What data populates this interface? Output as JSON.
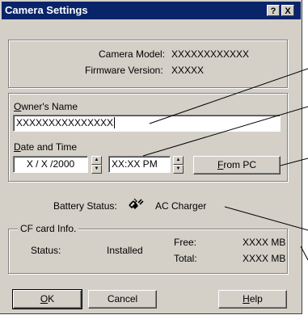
{
  "window": {
    "title": "Camera Settings",
    "help_btn": "?",
    "close_btn": "X"
  },
  "camera_info": {
    "model_label": "Camera Model:",
    "model_value": "XXXXXXXXXXXX",
    "firmware_label": "Firmware Version:",
    "firmware_value": "XXXXX"
  },
  "owner": {
    "label_first": "O",
    "label_rest": "wner's Name",
    "value": "XXXXXXXXXXXXXXX"
  },
  "datetime": {
    "label_first": "D",
    "label_rest": "ate and Time",
    "date_value": "X / X /2000",
    "time_value": "XX:XX PM",
    "from_pc_first": "F",
    "from_pc_rest": "rom PC"
  },
  "battery": {
    "label": "Battery Status:",
    "value": "AC Charger",
    "icon": "ac-plug-icon"
  },
  "cf_card": {
    "group_label": "CF card Info.",
    "status_label": "Status:",
    "status_value": "Installed",
    "free_label": "Free:",
    "free_value": "XXXX MB",
    "total_label": "Total:",
    "total_value": "XXXX MB"
  },
  "buttons": {
    "ok_first": "O",
    "ok_rest": "K",
    "cancel": "Cancel",
    "help_first": "H",
    "help_rest": "elp"
  }
}
